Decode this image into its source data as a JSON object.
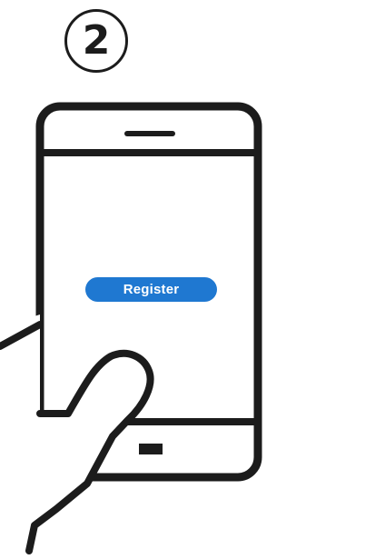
{
  "step": {
    "number": "2"
  },
  "phone": {
    "register_label": "Register"
  },
  "colors": {
    "outline": "#1c1c1c",
    "button": "#1f78d1",
    "button_text": "#ffffff",
    "background": "#ffffff"
  },
  "icons": {
    "phone": "smartphone-icon",
    "hand": "hand-icon",
    "speaker": "earpiece-icon",
    "home": "home-button-icon"
  }
}
